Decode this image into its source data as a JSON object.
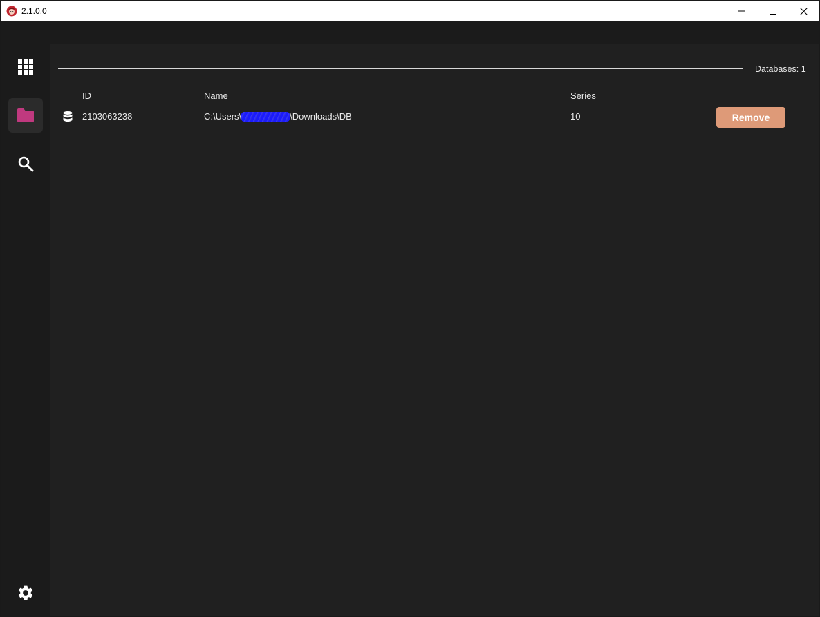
{
  "window": {
    "title": "2.1.0.0"
  },
  "sidebar": {
    "items": [
      {
        "name": "dashboard",
        "icon": "grid-icon",
        "active": false
      },
      {
        "name": "databases",
        "icon": "folder-icon",
        "active": true
      },
      {
        "name": "search",
        "icon": "search-icon",
        "active": false
      }
    ],
    "bottom_icon": "gear-icon"
  },
  "main": {
    "databases_count_label": "Databases: 1",
    "columns": {
      "id": "ID",
      "name": "Name",
      "series": "Series"
    },
    "rows": [
      {
        "icon": "database-icon",
        "id": "2103063238",
        "name_prefix": "C:\\Users\\",
        "name_suffix": "\\Downloads\\DB",
        "series": "10",
        "action": "Remove"
      }
    ]
  },
  "colors": {
    "accent": "#c0397f",
    "remove_button": "#de9a78",
    "background": "#202020",
    "sidebar": "#1b1b1b"
  }
}
